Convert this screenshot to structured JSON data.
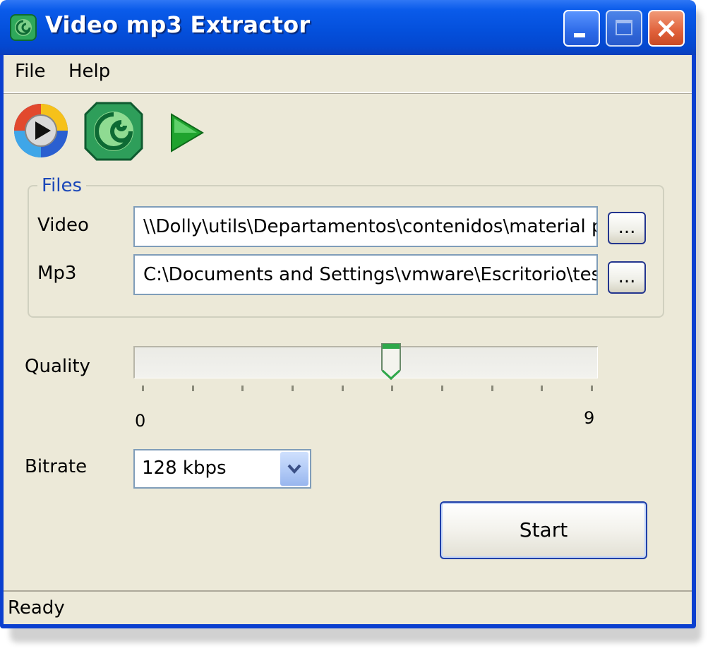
{
  "window": {
    "title": "Video mp3 Extractor",
    "controls": {
      "minimize": "minimize",
      "maximize": "maximize",
      "close": "×"
    }
  },
  "menu": {
    "items": [
      "File",
      "Help"
    ]
  },
  "toolbar": {
    "icons": [
      "media-player-icon",
      "app-logo-icon",
      "play-icon"
    ]
  },
  "files": {
    "group_label": "Files",
    "video": {
      "label": "Video",
      "value": "\\\\Dolly\\utils\\Departamentos\\contenidos\\material p",
      "browse": "..."
    },
    "mp3": {
      "label": "Mp3",
      "value": "C:\\Documents and Settings\\vmware\\Escritorio\\tes",
      "browse": "..."
    }
  },
  "quality": {
    "label": "Quality",
    "min": "0",
    "max": "9",
    "value": 5
  },
  "bitrate": {
    "label": "Bitrate",
    "selected": "128 kbps"
  },
  "start_label": "Start",
  "status": "Ready",
  "colors": {
    "title_bar": "#0450dc",
    "face": "#ece9d8",
    "group_label": "#1c48b8",
    "close": "#e0603a"
  }
}
